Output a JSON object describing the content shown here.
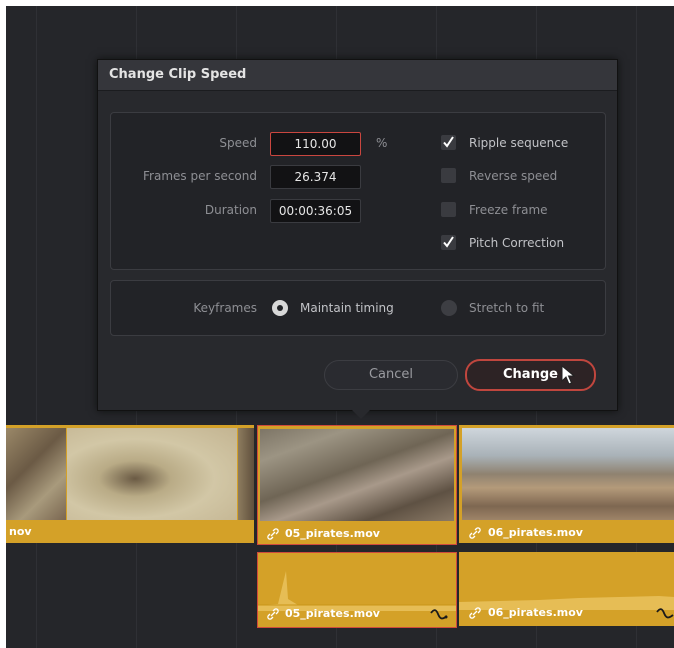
{
  "dialog": {
    "title": "Change Clip Speed",
    "speed_label": "Speed",
    "speed_value": "110.00",
    "speed_unit": "%",
    "fps_label": "Frames per second",
    "fps_value": "26.374",
    "duration_label": "Duration",
    "duration_value": "00:00:36:05",
    "options": [
      {
        "label": "Ripple sequence",
        "checked": true
      },
      {
        "label": "Reverse speed",
        "checked": false
      },
      {
        "label": "Freeze frame",
        "checked": false
      },
      {
        "label": "Pitch Correction",
        "checked": true
      }
    ],
    "keyframes_label": "Keyframes",
    "keyframe_options": [
      {
        "label": "Maintain timing",
        "selected": true
      },
      {
        "label": "Stretch to fit",
        "selected": false
      }
    ],
    "cancel_label": "Cancel",
    "change_label": "Change"
  },
  "timeline": {
    "video_clips": [
      {
        "name": "nov"
      },
      {
        "name": "05_pirates.mov"
      },
      {
        "name": "06_pirates.mov"
      }
    ],
    "audio_clips": [
      {
        "name": "05_pirates.mov"
      },
      {
        "name": "06_pirates.mov"
      }
    ]
  },
  "colors": {
    "accent": "#c9463f",
    "clip": "#d4a128",
    "background": "#25262a"
  }
}
